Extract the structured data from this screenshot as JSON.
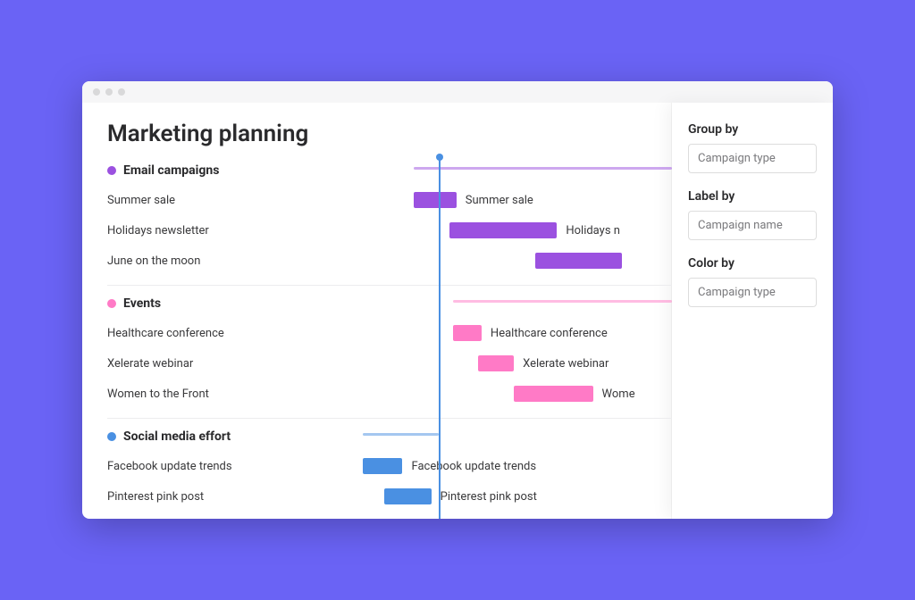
{
  "title": "Marketing planning",
  "today_position_pct": 35,
  "colors": {
    "purple": "#9b51e0",
    "pink": "#ff7ac6",
    "blue": "#4a90e2"
  },
  "groups": [
    {
      "name": "Email campaigns",
      "color": "purple",
      "range": {
        "start_pct": 28,
        "end_pct": 100
      },
      "items": [
        {
          "label": "Summer sale",
          "bar_label": "Summer sale",
          "start_pct": 28,
          "width_pct": 12
        },
        {
          "label": "Holidays newsletter",
          "bar_label": "Holidays n",
          "start_pct": 38,
          "width_pct": 30
        },
        {
          "label": "June on the moon",
          "bar_label": "",
          "start_pct": 62,
          "width_pct": 24
        }
      ]
    },
    {
      "name": "Events",
      "color": "pink",
      "range": {
        "start_pct": 39,
        "end_pct": 100
      },
      "items": [
        {
          "label": "Healthcare conference",
          "bar_label": "Healthcare conference",
          "start_pct": 39,
          "width_pct": 8
        },
        {
          "label": "Xelerate webinar",
          "bar_label": "Xelerate webinar",
          "start_pct": 46,
          "width_pct": 10
        },
        {
          "label": "Women to the Front",
          "bar_label": "Wome",
          "start_pct": 56,
          "width_pct": 22
        }
      ]
    },
    {
      "name": "Social media effort",
      "color": "blue",
      "range": {
        "start_pct": 14,
        "end_pct": 35
      },
      "items": [
        {
          "label": "Facebook update trends",
          "bar_label": "Facebook update trends",
          "start_pct": 14,
          "width_pct": 11
        },
        {
          "label": "Pinterest pink post",
          "bar_label": "Pinterest pink post",
          "start_pct": 20,
          "width_pct": 13
        }
      ]
    }
  ],
  "sidebar": {
    "group_by": {
      "label": "Group by",
      "value": "Campaign type"
    },
    "label_by": {
      "label": "Label by",
      "value": "Campaign name"
    },
    "color_by": {
      "label": "Color by",
      "value": "Campaign type"
    }
  },
  "chart_data": {
    "type": "gantt",
    "title": "Marketing planning",
    "groups": [
      {
        "group": "Email campaigns",
        "color": "#9b51e0",
        "tasks": [
          {
            "name": "Summer sale",
            "start": 28,
            "end": 40
          },
          {
            "name": "Holidays newsletter",
            "start": 38,
            "end": 68
          },
          {
            "name": "June on the moon",
            "start": 62,
            "end": 86
          }
        ]
      },
      {
        "group": "Events",
        "color": "#ff7ac6",
        "tasks": [
          {
            "name": "Healthcare conference",
            "start": 39,
            "end": 47
          },
          {
            "name": "Xelerate webinar",
            "start": 46,
            "end": 56
          },
          {
            "name": "Women to the Front",
            "start": 56,
            "end": 78
          }
        ]
      },
      {
        "group": "Social media effort",
        "color": "#4a90e2",
        "tasks": [
          {
            "name": "Facebook update trends",
            "start": 14,
            "end": 25
          },
          {
            "name": "Pinterest pink post",
            "start": 20,
            "end": 33
          }
        ]
      }
    ],
    "today_marker": 35,
    "x_unit": "percent_of_visible_range"
  }
}
